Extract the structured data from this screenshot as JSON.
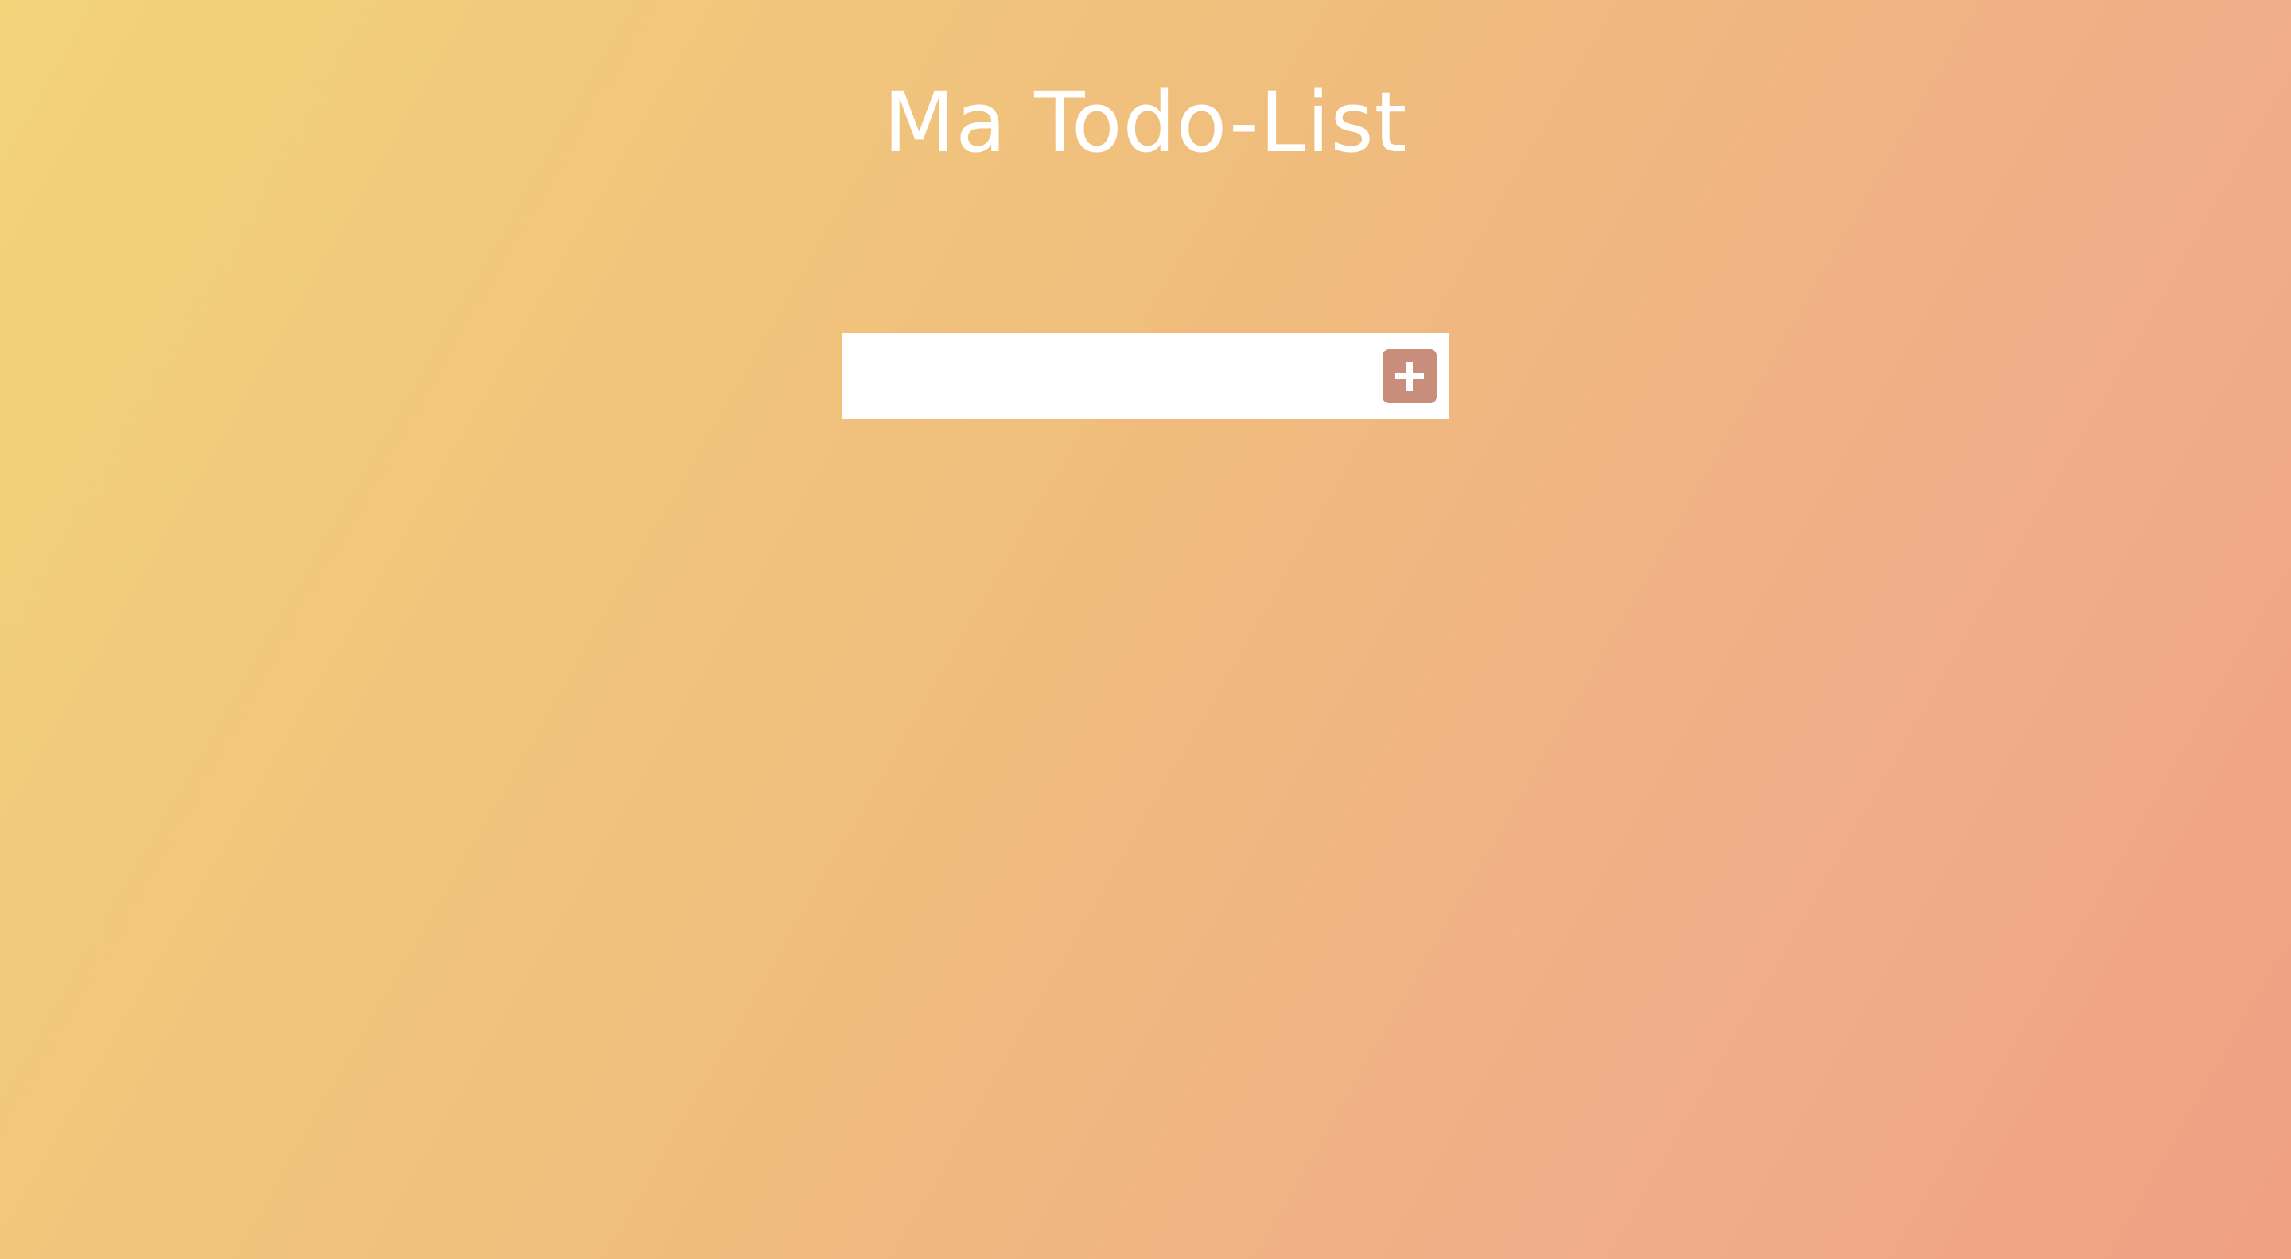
{
  "header": {
    "title": "Ma Todo-List"
  },
  "todo_form": {
    "input_value": "",
    "input_placeholder": "",
    "add_button_icon": "plus-icon"
  },
  "colors": {
    "gradient_start": "#f2d37a",
    "gradient_end": "#f0a083",
    "add_button": "#c98d7c",
    "title_text": "#ffffff"
  }
}
